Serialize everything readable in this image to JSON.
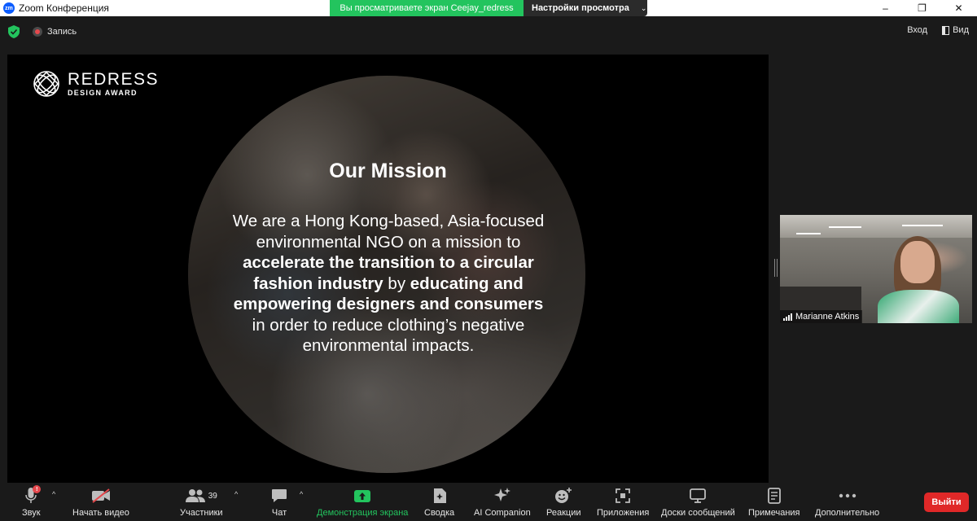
{
  "window": {
    "app_icon_text": "zm",
    "title": "Zoom Конференция",
    "share_banner": "Вы просматриваете экран Ceejay_redress",
    "view_options": "Настройки просмотра",
    "controls": [
      "–",
      "❐",
      "✕"
    ]
  },
  "meeting_bar": {
    "recording_label": "Запись",
    "enter_label": "Вход",
    "view_label": "Вид"
  },
  "slide": {
    "logo": {
      "main": "REDRESS",
      "sub": "DESIGN AWARD"
    },
    "heading": "Our Mission",
    "body": [
      {
        "text": "We are a Hong Kong-based, Asia-focused environmental NGO on a mission to ",
        "bold": false
      },
      {
        "text": "accelerate the transition to a circular fashion industry",
        "bold": true
      },
      {
        "text": " by ",
        "bold": false
      },
      {
        "text": "educating and empowering designers and consumers",
        "bold": true
      },
      {
        "text": " in order to reduce clothing’s negative environmental impacts.",
        "bold": false
      }
    ]
  },
  "participant": {
    "name": "Marianne Atkins"
  },
  "toolbar": {
    "audio": {
      "label": "Звук",
      "badge": "!"
    },
    "video": {
      "label": "Начать видео"
    },
    "participants": {
      "label": "Участники",
      "count": "39"
    },
    "chat": {
      "label": "Чат"
    },
    "share": {
      "label": "Демонстрация экрана"
    },
    "summary": {
      "label": "Сводка"
    },
    "ai": {
      "label": "AI Companion"
    },
    "reactions": {
      "label": "Реакции"
    },
    "apps": {
      "label": "Приложения"
    },
    "whiteboards": {
      "label": "Доски сообщений"
    },
    "notes": {
      "label": "Примечания"
    },
    "more": {
      "label": "Дополнительно"
    },
    "leave": {
      "label": "Выйти"
    }
  },
  "colors": {
    "share_green": "#23c45e",
    "leave_red": "#e02828",
    "zoom_blue": "#0b5cff"
  }
}
